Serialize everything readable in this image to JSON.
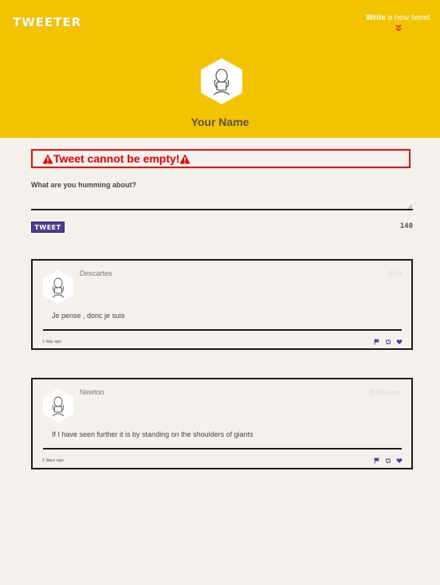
{
  "header": {
    "logo": "TWEETER",
    "write_prefix": "Write",
    "write_suffix": " a new tweet",
    "profile_name": "Your Name"
  },
  "compose": {
    "error": "Tweet cannot be empty!",
    "label": "What are you humming about?",
    "input_value": "",
    "button_label": "TWEET",
    "counter": "140"
  },
  "tweets": [
    {
      "author": "Descartes",
      "handle": "@rd",
      "body": "Je pense , donc je suis",
      "time": "1 day ago"
    },
    {
      "author": "Newton",
      "handle": "@SirIsaac",
      "body": "If I have seen further it is by standing on the shoulders of giants",
      "time": "2 days ago"
    }
  ],
  "icons": {
    "chevron": "double-chevron-down-icon",
    "warning": "warning-icon",
    "flag": "flag-icon",
    "retweet": "retweet-icon",
    "like": "heart-icon"
  },
  "colors": {
    "header_bg": "#f4c300",
    "page_bg": "#f4f1ec",
    "error_red": "#ee1111",
    "accent_purple": "#4b3f94",
    "chevron_red": "#e0322b"
  }
}
